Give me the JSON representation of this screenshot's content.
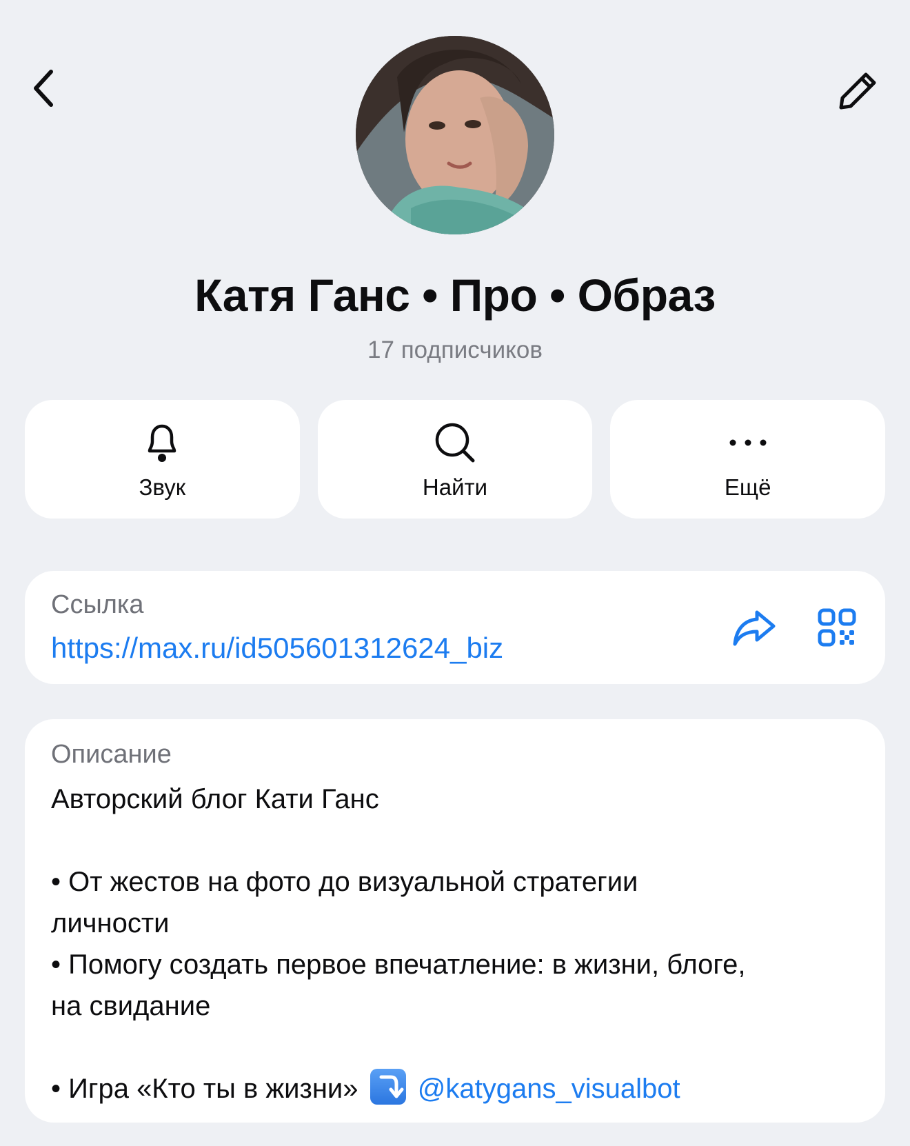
{
  "header": {
    "back_icon": "chevron-left-icon",
    "edit_icon": "pencil-icon"
  },
  "profile": {
    "name": "Катя Ганс • Про • Образ",
    "subscribers": "17 подписчиков"
  },
  "actions": [
    {
      "label": "Звук",
      "icon": "bell-icon"
    },
    {
      "label": "Найти",
      "icon": "search-icon"
    },
    {
      "label": "Ещё",
      "icon": "more-icon"
    }
  ],
  "link": {
    "label": "Ссылка",
    "url": "https://max.ru/id505601312624_biz"
  },
  "description": {
    "label": "Описание",
    "line1": "Авторский блог Кати Ганс",
    "line2": "• От жестов на фото до визуальной стратегии",
    "line3": "личности",
    "line4": "• Помогу создать первое впечатление: в жизни, блоге,",
    "line5": "на свидание",
    "line6_prefix": "• Игра «Кто ты в жизни»",
    "mention": "@katygans_visualbot"
  },
  "colors": {
    "background": "#eef0f4",
    "card": "#ffffff",
    "accent": "#1c7cf0",
    "secondary_text": "#7a7c83"
  }
}
